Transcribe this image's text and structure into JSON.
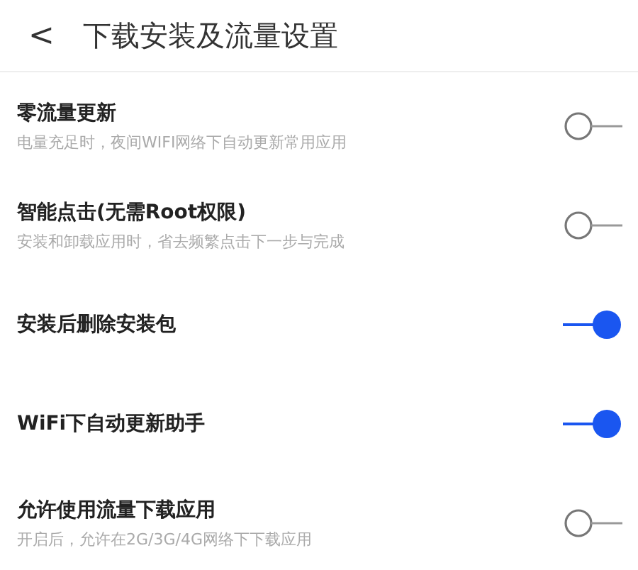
{
  "header": {
    "back": "<",
    "title": "下载安装及流量设置"
  },
  "settings": [
    {
      "title": "零流量更新",
      "subtitle": "电量充足时，夜间WIFI网络下自动更新常用应用",
      "on": false
    },
    {
      "title": "智能点击(无需Root权限)",
      "subtitle": "安装和卸载应用时，省去频繁点击下一步与完成",
      "on": false
    },
    {
      "title": "安装后删除安装包",
      "on": true
    },
    {
      "title": "WiFi下自动更新助手",
      "on": true
    },
    {
      "title": "允许使用流量下载应用",
      "subtitle": "开启后，允许在2G/3G/4G网络下下载应用",
      "on": false
    }
  ]
}
